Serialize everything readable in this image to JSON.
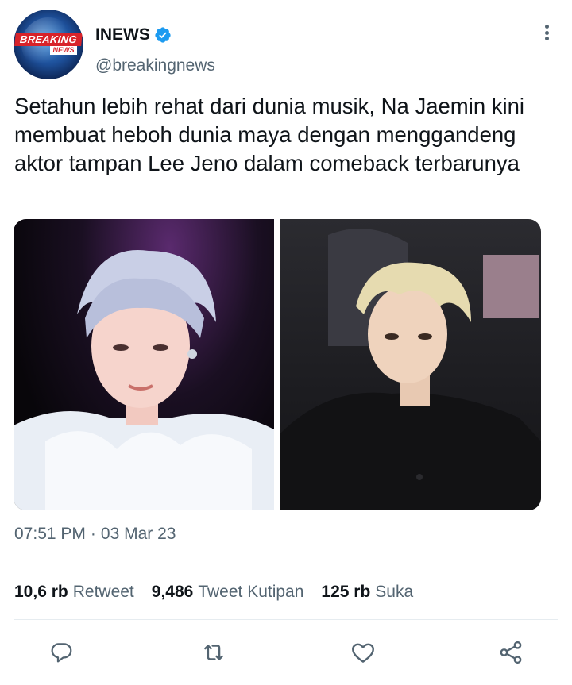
{
  "account": {
    "display_name": "INEWS",
    "handle": "@breakingnews",
    "verified": true,
    "avatar_label_top": "BREAKING",
    "avatar_label_bottom": "NEWS"
  },
  "tweet": {
    "text": "Setahun lebih rehat dari dunia musik, Na Jaemin kini membuat heboh dunia maya dengan menggandeng aktor tampan Lee Jeno dalam comeback terbarunya",
    "time": "07:51 PM",
    "separator": "·",
    "date": "03 Mar 23"
  },
  "media": [
    {
      "icon": "photo-icon",
      "description_hidden": true
    },
    {
      "icon": "photo-icon",
      "description_hidden": true
    }
  ],
  "stats": {
    "retweets_count": "10,6 rb",
    "retweets_label": "Retweet",
    "quotes_count": "9,486",
    "quotes_label": "Tweet Kutipan",
    "likes_count": "125 rb",
    "likes_label": "Suka"
  },
  "actions": [
    {
      "name": "reply",
      "icon": "reply-icon"
    },
    {
      "name": "retweet",
      "icon": "retweet-icon"
    },
    {
      "name": "like",
      "icon": "heart-icon"
    },
    {
      "name": "share",
      "icon": "share-icon"
    }
  ],
  "colors": {
    "text_primary": "#0f1419",
    "text_secondary": "#536471",
    "verified_blue": "#1d9bf0",
    "divider": "#e6ecf0",
    "brand_red": "#d8232a"
  }
}
